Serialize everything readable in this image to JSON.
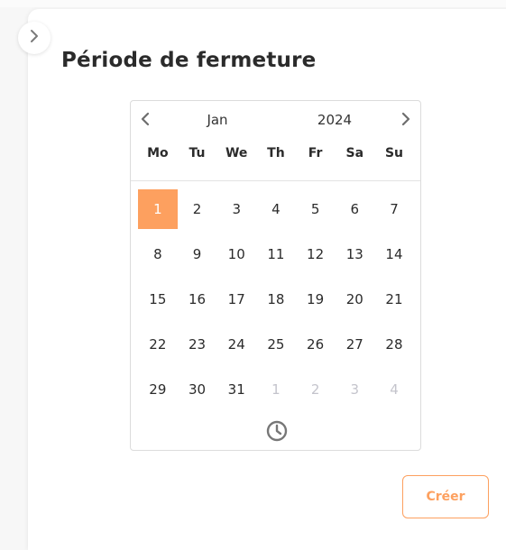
{
  "page": {
    "title": "Période de fermeture",
    "create_button_label": "Créer"
  },
  "calendar": {
    "month": "Jan",
    "year": "2024",
    "weekdays": [
      "Mo",
      "Tu",
      "We",
      "Th",
      "Fr",
      "Sa",
      "Su"
    ],
    "selected_day": "1",
    "days": [
      {
        "label": "1",
        "muted": false
      },
      {
        "label": "2",
        "muted": false
      },
      {
        "label": "3",
        "muted": false
      },
      {
        "label": "4",
        "muted": false
      },
      {
        "label": "5",
        "muted": false
      },
      {
        "label": "6",
        "muted": false
      },
      {
        "label": "7",
        "muted": false
      },
      {
        "label": "8",
        "muted": false
      },
      {
        "label": "9",
        "muted": false
      },
      {
        "label": "10",
        "muted": false
      },
      {
        "label": "11",
        "muted": false
      },
      {
        "label": "12",
        "muted": false
      },
      {
        "label": "13",
        "muted": false
      },
      {
        "label": "14",
        "muted": false
      },
      {
        "label": "15",
        "muted": false
      },
      {
        "label": "16",
        "muted": false
      },
      {
        "label": "17",
        "muted": false
      },
      {
        "label": "18",
        "muted": false
      },
      {
        "label": "19",
        "muted": false
      },
      {
        "label": "20",
        "muted": false
      },
      {
        "label": "21",
        "muted": false
      },
      {
        "label": "22",
        "muted": false
      },
      {
        "label": "23",
        "muted": false
      },
      {
        "label": "24",
        "muted": false
      },
      {
        "label": "25",
        "muted": false
      },
      {
        "label": "26",
        "muted": false
      },
      {
        "label": "27",
        "muted": false
      },
      {
        "label": "28",
        "muted": false
      },
      {
        "label": "29",
        "muted": false
      },
      {
        "label": "30",
        "muted": false
      },
      {
        "label": "31",
        "muted": false
      },
      {
        "label": "1",
        "muted": true
      },
      {
        "label": "2",
        "muted": true
      },
      {
        "label": "3",
        "muted": true
      },
      {
        "label": "4",
        "muted": true
      }
    ]
  },
  "icons": {
    "collapse": "chevron-right-icon",
    "prev": "chevron-left-icon",
    "next": "chevron-right-icon",
    "time": "clock-icon"
  },
  "colors": {
    "accent": "#fda05f",
    "text": "#2b2b2b",
    "muted": "#c4c4cc"
  }
}
